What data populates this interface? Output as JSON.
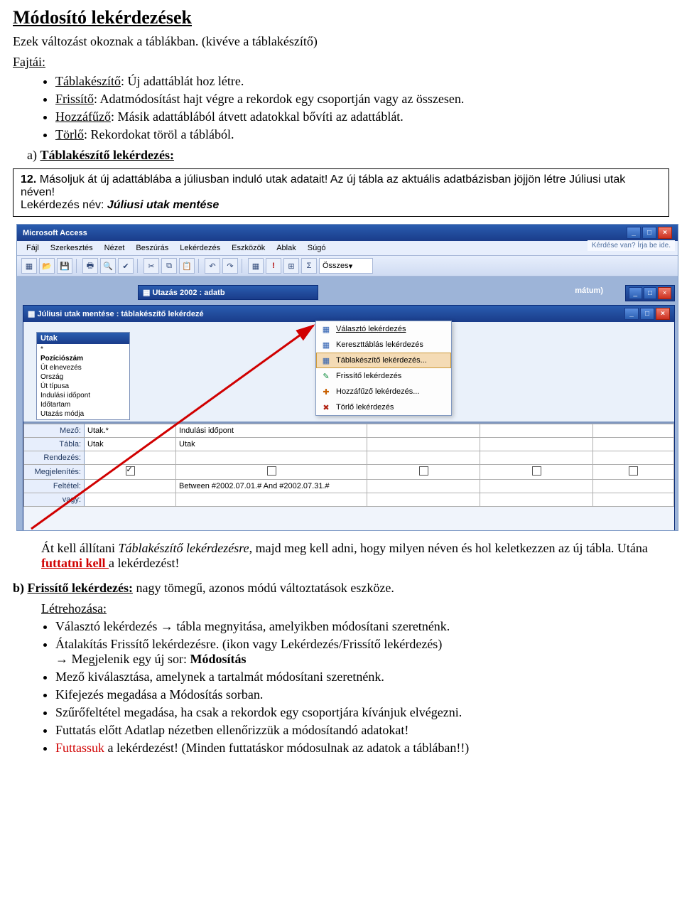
{
  "doc": {
    "title": "Módosító lekérdezések",
    "intro": "Ezek változást okoznak a táblákban. (kivéve a táblakészítő)",
    "fajtai_label": "Fajtái:",
    "types": [
      {
        "name": "Táblakészítő",
        "rest": ": Új adattáblát hoz létre."
      },
      {
        "name": "Frissítő",
        "rest": ": Adatmódosítást hajt végre a rekordok egy csoportján vagy az összesen."
      },
      {
        "name": "Hozzáfűző",
        "rest": ": Másik adattáblából átvett adatokkal bővíti az adattáblát."
      },
      {
        "name": "Törlő",
        "rest": ": Rekordokat töröl a táblából."
      }
    ],
    "a_label": "a)",
    "a_title": "Táblakészítő lekérdezés:",
    "task": {
      "num": "12.",
      "text1": "Másoljuk át új adattáblába a júliusban induló utak adatait! Az új tábla az aktuális adatbázisban jöjjön létre Júliusi utak néven!",
      "label": "Lekérdezés név:",
      "qname": "Júliusi utak mentése"
    },
    "after1a": "Át kell állítani ",
    "after1b": "Táblakészítő lekérdezésre",
    "after1c": ", majd meg kell adni, hogy milyen néven és hol keletkezzen az új tábla. Utána ",
    "after1d": "futtatni kell ",
    "after1e": "a lekérdezést!",
    "b_label": "b)",
    "b_title": "Frissítő lekérdezés:",
    "b_rest": " nagy tömegű, azonos módú változtatások eszköze.",
    "letrehozasa": "Létrehozása:",
    "b_bullets": [
      {
        "t": "Választó lekérdezés → tábla megnyitása, amelyikben módosítani szeretnénk."
      },
      {
        "t1": "Átalakítás Frissítő lekérdezésre. (ikon vagy Lekérdezés/Frissítő lekérdezés)",
        "t2": "→ Megjelenik egy új sor: ",
        "t2b": "Módosítás"
      },
      {
        "t": "Mező kiválasztása, amelynek a tartalmát módosítani szeretnénk."
      },
      {
        "t": "Kifejezés megadása a Módosítás sorban."
      },
      {
        "t": "Szűrőfeltétel megadása, ha csak a rekordok egy csoportjára kívánjuk elvégezni."
      },
      {
        "t": "Futtatás előtt Adatlap nézetben ellenőrizzük a módosítandó adatokat!"
      },
      {
        "tred": "Futtassuk ",
        "trest": "a lekérdezést! (Minden futtatáskor módosulnak az adatok a táblában!!)"
      }
    ]
  },
  "access": {
    "app_title": "Microsoft Access",
    "ask_hint": "Kérdése van? Írja be ide.",
    "menu": [
      "Fájl",
      "Szerkesztés",
      "Nézet",
      "Beszúrás",
      "Lekérdezés",
      "Eszközök",
      "Ablak",
      "Súgó"
    ],
    "toolbar_icons": [
      "new-doc-icon",
      "open-icon",
      "save-icon",
      "print-icon",
      "print-preview-icon",
      "spell-icon",
      "cut-icon",
      "copy-icon",
      "paste-icon",
      "undo-icon",
      "redo-icon",
      "query-type-icon",
      "run-icon",
      "show-table-icon",
      "totals-icon"
    ],
    "toolbar_glyphs": [
      "▦",
      "📂",
      "💾",
      "|",
      "🖶",
      "🔍",
      "✔",
      "|",
      "✂",
      "⧉",
      "📋",
      "|",
      "↶",
      "↷",
      "|",
      "▦",
      "!",
      "⊞",
      "Σ"
    ],
    "toolbar_combo": "Összes",
    "db_title_prefix": "Utazás 2002 : adatb",
    "db_subtitle_suffix": "mátum)",
    "qry_title": "Júliusi utak mentése : táblakészítő lekérdezé",
    "table_box": {
      "title": "Utak",
      "fields": [
        "*",
        "Pozíciószám",
        "Út elnevezés",
        "Ország",
        "Út típusa",
        "Indulási időpont",
        "Időtartam",
        "Utazás módja"
      ]
    },
    "dropdown": [
      {
        "icon": "select-query-icon",
        "cls": "blue",
        "glyph": "▦",
        "label": "Választó lekérdezés"
      },
      {
        "icon": "crosstab-query-icon",
        "cls": "blue",
        "glyph": "▦",
        "label": "Kereszttáblás lekérdezés"
      },
      {
        "icon": "maketable-query-icon",
        "cls": "blue",
        "glyph": "▦",
        "label": "Táblakészítő lekérdezés...",
        "selected": true
      },
      {
        "icon": "update-query-icon",
        "cls": "green",
        "glyph": "✎",
        "label": "Frissítő lekérdezés"
      },
      {
        "icon": "append-query-icon",
        "cls": "orange",
        "glyph": "✚",
        "label": "Hozzáfűző lekérdezés..."
      },
      {
        "icon": "delete-query-icon",
        "cls": "red",
        "glyph": "✖",
        "label": "Törlő lekérdezés"
      }
    ],
    "grid": {
      "rows": [
        "Mező:",
        "Tábla:",
        "Rendezés:",
        "Megjelenítés:",
        "Feltétel:",
        "vagy:"
      ],
      "col1": {
        "mezo": "Utak.*",
        "tabla": "Utak",
        "rendezes": "",
        "megjelen": true,
        "feltetel": "",
        "vagy": ""
      },
      "col2": {
        "mezo": "Indulási időpont",
        "tabla": "Utak",
        "rendezes": "",
        "megjelen": false,
        "feltetel": "Between #2002.07.01.# And #2002.07.31.#",
        "vagy": ""
      }
    }
  }
}
